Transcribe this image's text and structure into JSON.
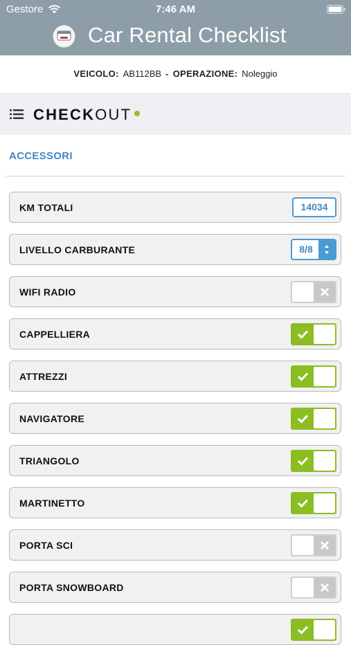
{
  "status_bar": {
    "carrier": "Gestore",
    "time": "7:46 AM"
  },
  "header": {
    "title": "Car Rental Checklist"
  },
  "info": {
    "vehicle_label": "VEICOLO:",
    "vehicle_value": "AB112BB",
    "separator": "-",
    "operation_label": "OPERAZIONE:",
    "operation_value": "Noleggio"
  },
  "section": {
    "title_bold": "CHECK",
    "title_rest": "OUT",
    "status_color": "#8fbf2a"
  },
  "group": {
    "title": "ACCESSORI"
  },
  "rows": [
    {
      "label": "KM TOTALI",
      "control": "number",
      "value": "14034"
    },
    {
      "label": "LIVELLO CARBURANTE",
      "control": "select",
      "value": "8/8"
    },
    {
      "label": "WIFI RADIO",
      "control": "toggle",
      "on": false
    },
    {
      "label": "CAPPELLIERA",
      "control": "toggle",
      "on": true
    },
    {
      "label": "ATTREZZI",
      "control": "toggle",
      "on": true
    },
    {
      "label": "NAVIGATORE",
      "control": "toggle",
      "on": true
    },
    {
      "label": "TRIANGOLO",
      "control": "toggle",
      "on": true
    },
    {
      "label": "MARTINETTO",
      "control": "toggle",
      "on": true
    },
    {
      "label": "PORTA SCI",
      "control": "toggle",
      "on": false
    },
    {
      "label": "PORTA SNOWBOARD",
      "control": "toggle",
      "on": false
    },
    {
      "label": "",
      "control": "toggle",
      "on": true
    }
  ],
  "colors": {
    "header_bg": "#8e9ea8",
    "accent_blue": "#4a9ad4",
    "toggle_on": "#8cbd22",
    "toggle_off": "#c8c8c8"
  },
  "icons": {
    "wifi": "wifi-icon",
    "battery": "battery-icon",
    "logo": "car-card-logo-icon",
    "list": "list-icon",
    "check": "check-icon",
    "cross": "cross-icon",
    "stepper": "up-down-arrows-icon"
  }
}
